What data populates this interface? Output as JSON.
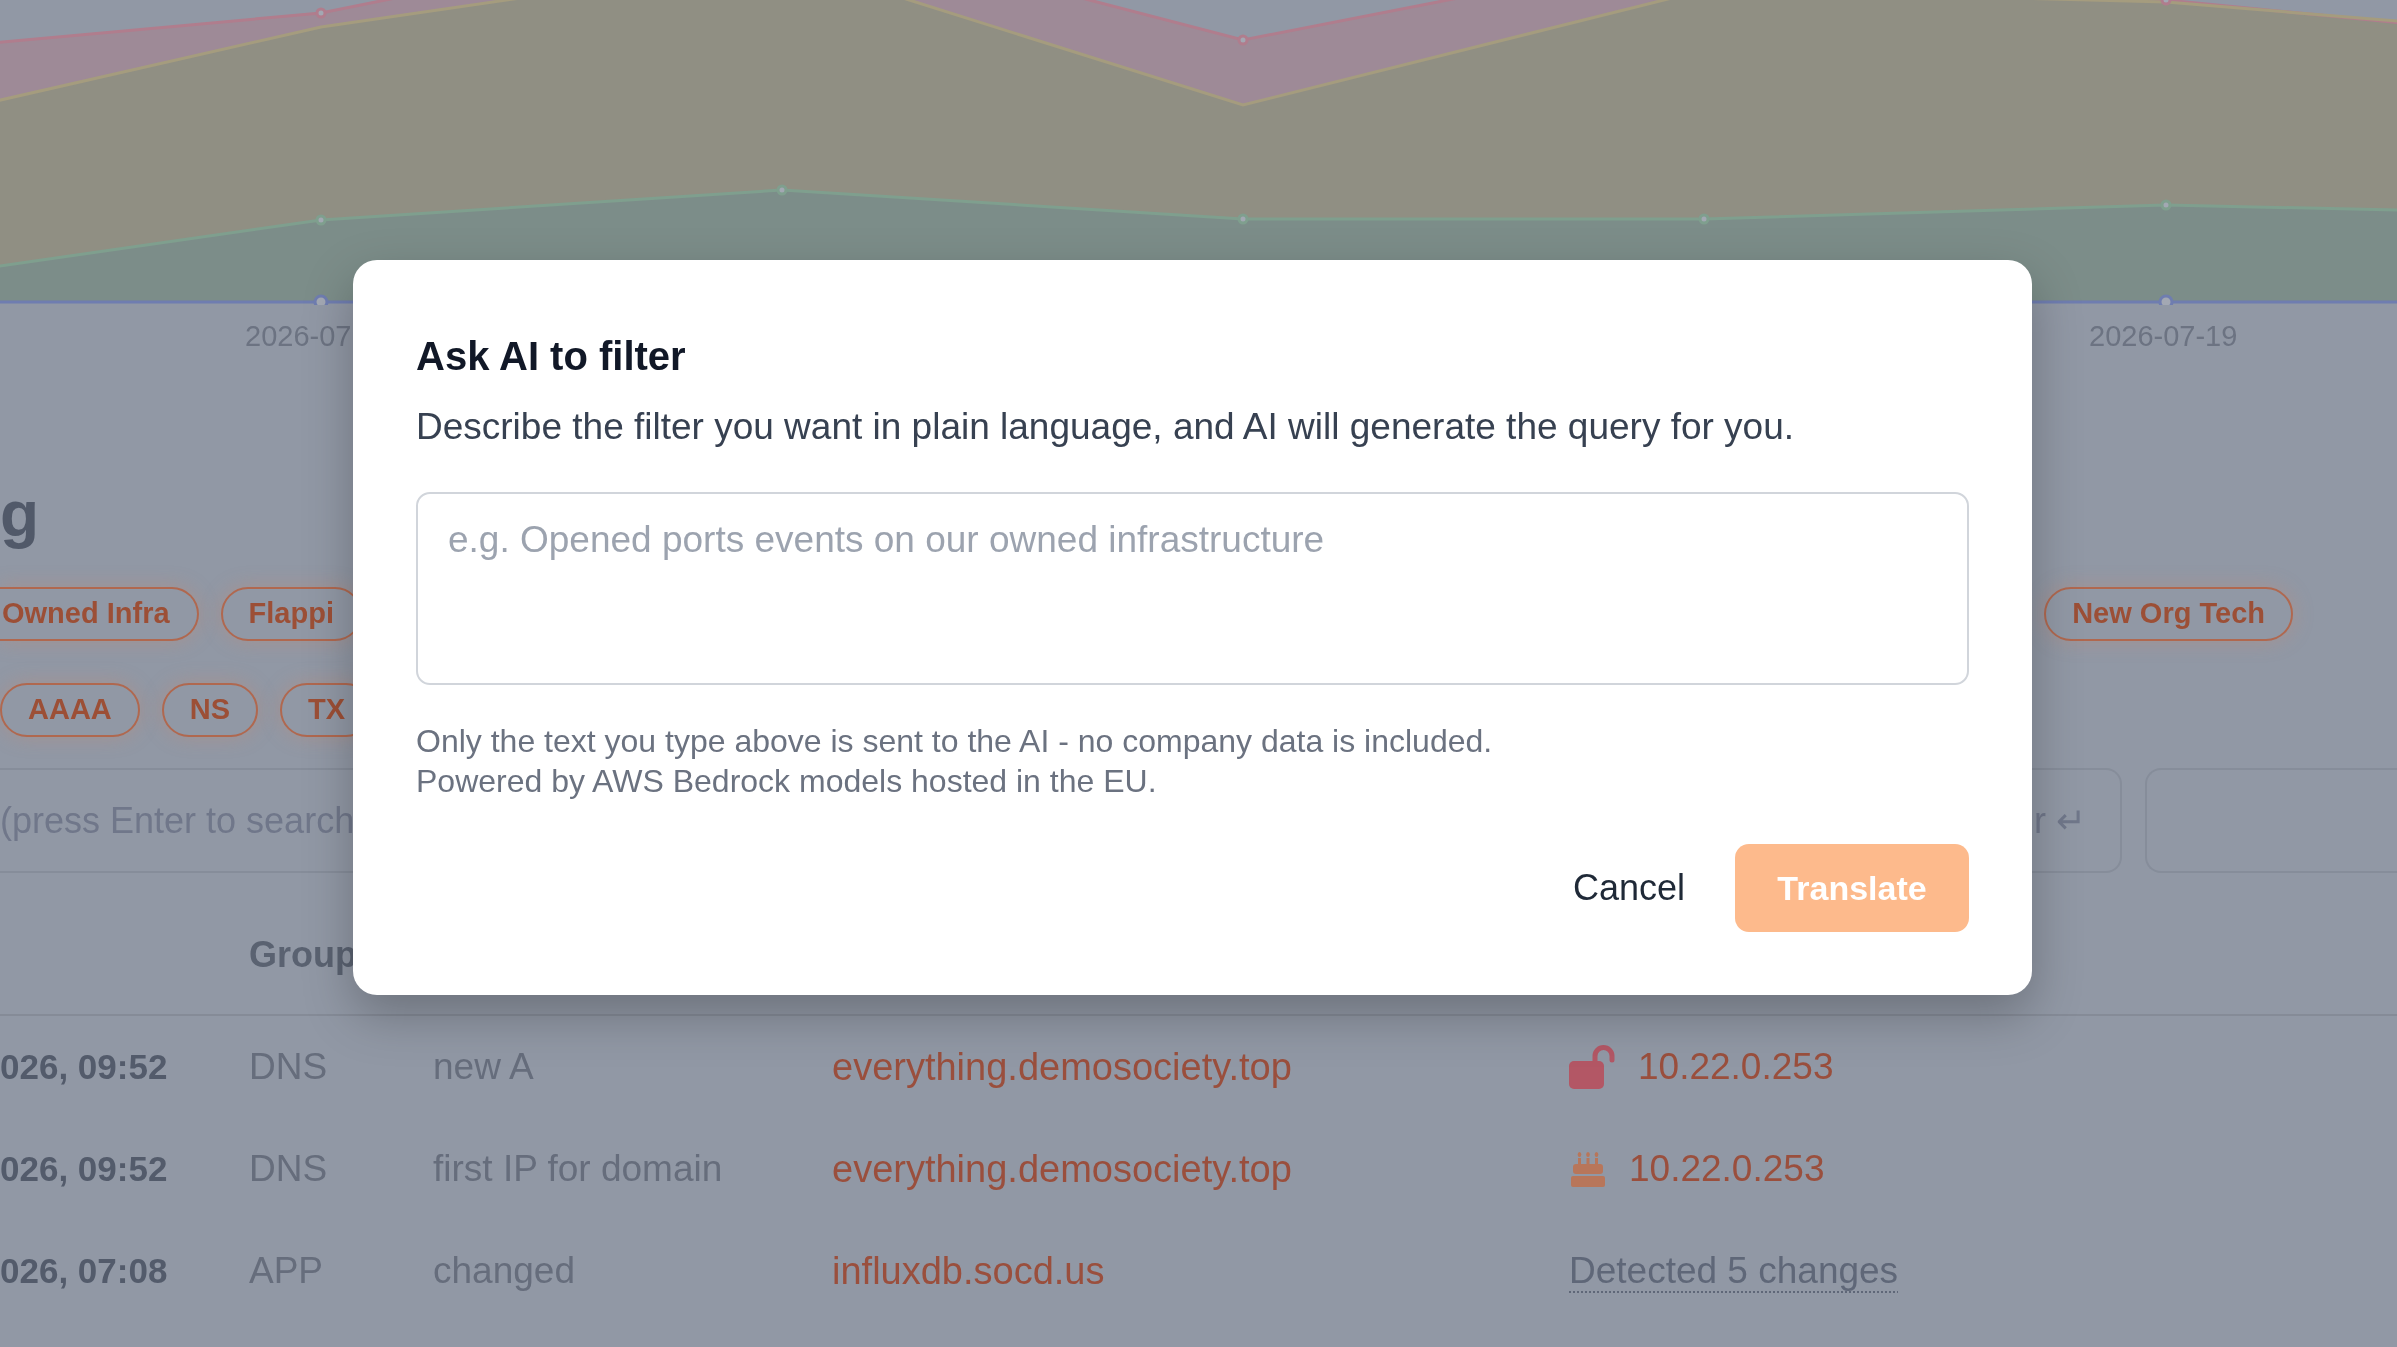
{
  "chart": {
    "axis_labels": [
      "2026-07",
      "2026-07-19"
    ]
  },
  "page_title": "g",
  "saved_filters": {
    "left": [
      "Owned Infra",
      "Flappi"
    ],
    "right": [
      "New Org Tech"
    ]
  },
  "record_types": [
    "AAAA",
    "NS",
    "TX"
  ],
  "search": {
    "placeholder": "(press Enter to search",
    "hint": "r ↵"
  },
  "table": {
    "columns": {
      "group": "Group"
    },
    "rows": [
      {
        "time": "026, 09:52",
        "group": "DNS",
        "event": "new A",
        "domain": "everything.demosociety.top",
        "detail": {
          "kind": "exposed",
          "text": "10.22.0.253"
        }
      },
      {
        "time": "026, 09:52",
        "group": "DNS",
        "event": "first IP for domain",
        "domain": "everything.demosociety.top",
        "detail": {
          "kind": "new",
          "text": "10.22.0.253"
        }
      },
      {
        "time": "026, 07:08",
        "group": "APP",
        "event": "changed",
        "domain": "influxdb.socd.us",
        "detail": {
          "kind": "changes",
          "text": "Detected 5 changes"
        }
      }
    ]
  },
  "dialog": {
    "title": "Ask AI to filter",
    "description": "Describe the filter you want in plain language, and AI will generate the query for you.",
    "query": {
      "placeholder": "e.g. Opened ports events on our owned infrastructure"
    },
    "notes": [
      "Only the text you type above is sent to the AI - no company data is included.",
      "Powered by AWS Bedrock models hosted in the EU."
    ],
    "buttons": [
      {
        "label": "Cancel",
        "kind": "secondary",
        "disabled": false
      },
      {
        "label": "Translate",
        "kind": "primary",
        "disabled": true
      }
    ]
  }
}
